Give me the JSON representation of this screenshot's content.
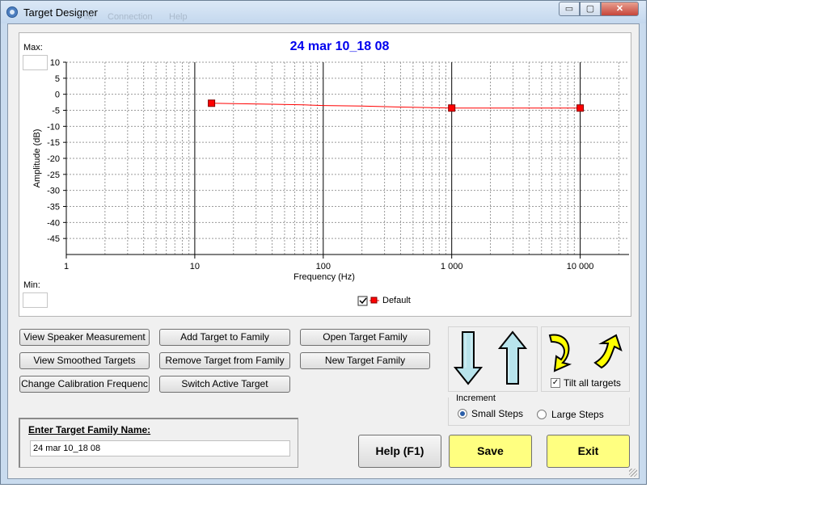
{
  "window": {
    "title": "Target Designer",
    "menu": [
      "File",
      "Connection",
      "Help"
    ],
    "controls": {
      "minimize": "▭",
      "maximize": "▢",
      "close": "✕"
    }
  },
  "chart": {
    "max_label": "Max:",
    "min_label": "Min:",
    "legend": {
      "label": "Default",
      "checked": true
    }
  },
  "chart_data": {
    "type": "line",
    "title": "24 mar 10_18 08",
    "xlabel": "Frequency (Hz)",
    "ylabel": "Amplitude (dB)",
    "xscale": "log",
    "xlim": [
      1,
      24000
    ],
    "ylim": [
      -50,
      10
    ],
    "xticks": [
      "1",
      "10",
      "100",
      "1 000",
      "10 000"
    ],
    "yticks": [
      "10",
      "5",
      "0",
      "-5",
      "-10",
      "-15",
      "-20",
      "-25",
      "-30",
      "-35",
      "-40",
      "-45"
    ],
    "grid": true,
    "legend_position": "bottom-center",
    "series": [
      {
        "name": "Default",
        "color": "#ff0000",
        "x": [
          13.5,
          20,
          40,
          70,
          100,
          200,
          400,
          700,
          1000,
          2000,
          5000,
          10000
        ],
        "y": [
          -2.8,
          -2.9,
          -3.1,
          -3.3,
          -3.5,
          -3.7,
          -4.0,
          -4.2,
          -4.3,
          -4.3,
          -4.3,
          -4.3
        ],
        "markers": [
          {
            "x": 13.5,
            "y": -2.8
          },
          {
            "x": 1000,
            "y": -4.3
          },
          {
            "x": 10000,
            "y": -4.3
          }
        ]
      }
    ]
  },
  "buttons": {
    "view_speaker": "View Speaker Measurement",
    "view_smoothed": "View Smoothed Targets",
    "change_cal": "Change  Calibration Frequenc",
    "add_target": "Add Target to Family",
    "remove_target": "Remove Target from Family",
    "switch_target": "Switch Active Target",
    "open_family": "Open Target Family",
    "new_family": "New Target Family",
    "help": "Help (F1)",
    "save": "Save",
    "exit": "Exit"
  },
  "tilt": {
    "label": "Tilt all targets",
    "checked": true
  },
  "increment": {
    "label": "Increment",
    "small": "Small Steps",
    "large": "Large Steps",
    "selected": "Small Steps"
  },
  "family": {
    "label": "Enter Target Family Name:",
    "value": "24 mar 10_18 08"
  },
  "colors": {
    "title_blue": "#0000ee",
    "arrow_fill": "#b8e4ec",
    "curve_arrow_fill": "#ffff00",
    "yellow_button": "#ffff80"
  }
}
